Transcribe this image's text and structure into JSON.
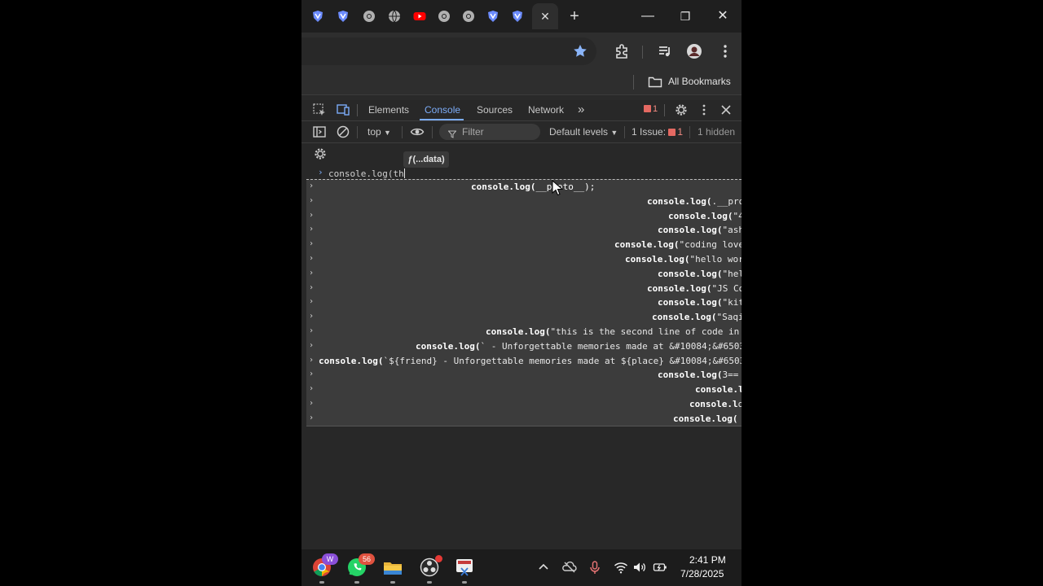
{
  "browser": {
    "tabs": [
      {
        "icon": "shield-v-icon",
        "color": "#6c8cff"
      },
      {
        "icon": "shield-v-icon",
        "color": "#6c8cff"
      },
      {
        "icon": "chrome-icon",
        "color": "#b0b0b0"
      },
      {
        "icon": "globe-icon",
        "color": "#b0b0b0"
      },
      {
        "icon": "youtube-icon",
        "color": "#ff0000"
      },
      {
        "icon": "chrome-icon",
        "color": "#b0b0b0"
      },
      {
        "icon": "chrome-icon",
        "color": "#b0b0b0"
      },
      {
        "icon": "shield-v-icon",
        "color": "#6c8cff"
      },
      {
        "icon": "shield-v-icon",
        "color": "#6c8cff"
      }
    ],
    "active_tab_close": "✕",
    "new_tab": "+",
    "window_controls": {
      "minimize": "—",
      "maximize": "❐",
      "close": "✕"
    },
    "bookmarks_label": "All Bookmarks"
  },
  "devtools": {
    "tabs": [
      "Elements",
      "Console",
      "Sources",
      "Network"
    ],
    "active_tab": "Console",
    "more_tabs": "»",
    "error_count": "1",
    "context": "top",
    "filter_placeholder": "Filter",
    "levels": "Default levels",
    "issues_label": "1 Issue:",
    "issues_count": "1",
    "hidden": "1 hidden"
  },
  "console": {
    "tooltip": "ƒ(...data)",
    "prompt": "console.log(th",
    "suggestions": [
      {
        "text": "console.log(__proto__);",
        "selected": true
      },
      {
        "text": "console.log(.__pro"
      },
      {
        "text": "console.log(\"4"
      },
      {
        "text": "console.log(\"ash"
      },
      {
        "text": "console.log(\"coding love"
      },
      {
        "text": "console.log(\"hello wor"
      },
      {
        "text": "console.log(\"hel"
      },
      {
        "text": "console.log(\"JS Co"
      },
      {
        "text": "console.log(\"kit"
      },
      {
        "text": "console.log(\"Saqi"
      },
      {
        "text": "console.log(\"this is the second line of code in"
      },
      {
        "text": "console.log(` - Unforgettable memories made at &#10084;&#6503"
      },
      {
        "text": "console.log(`${friend} - Unforgettable memories made at ${place} &#10084;&#6503"
      },
      {
        "text": "console.log(3=="
      },
      {
        "text": "console.l"
      },
      {
        "text": "console.lo"
      },
      {
        "text": "console.log("
      }
    ]
  },
  "taskbar": {
    "chrome_badge": "W",
    "whatsapp_badge": "56",
    "time": "2:41 PM",
    "date": "7/28/2025"
  },
  "colors": {
    "accent": "#7cacf8",
    "error": "#e46962",
    "star": "#8ab4f8"
  }
}
